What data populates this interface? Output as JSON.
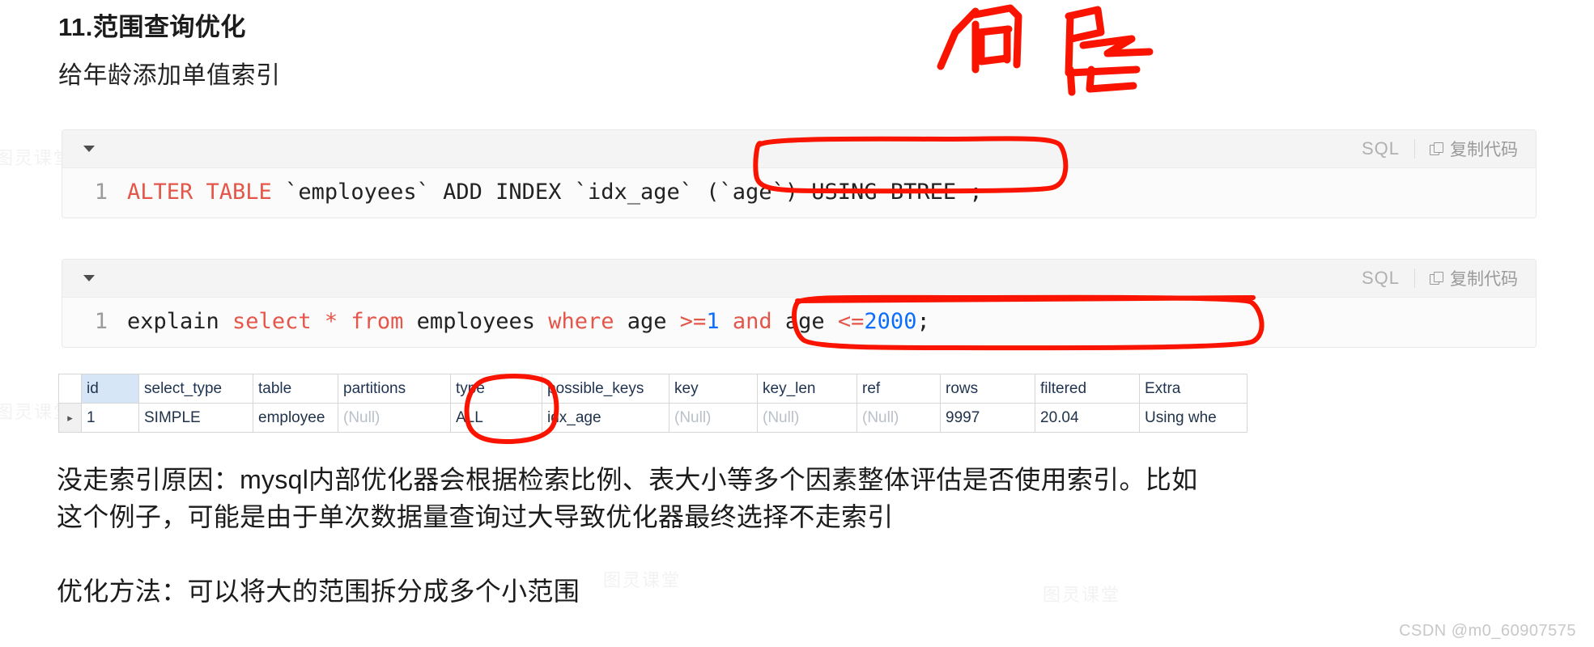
{
  "page": {
    "title": "11.范围查询优化",
    "subtitle": "给年龄添加单值索引",
    "watermark": "CSDN @m0_60907575",
    "bg_watermark": "图灵课堂",
    "accent_red": "#e45649",
    "accent_blue": "#0d6efd",
    "annotation_red": "#fa1400"
  },
  "code_blocks": [
    {
      "lang": "SQL",
      "copy_label": "复制代码",
      "copy_icon": "copy-icon",
      "collapse_icon": "triangle-down-icon",
      "line_number": "1",
      "tokens": [
        {
          "t": "ALTER TABLE",
          "c": "kw"
        },
        {
          "t": " `employees` ADD INDEX `idx_age` (`age`) USING BTREE ;",
          "c": ""
        }
      ],
      "plain": "ALTER TABLE `employees` ADD INDEX `idx_age` (`age`) USING BTREE ;"
    },
    {
      "lang": "SQL",
      "copy_label": "复制代码",
      "copy_icon": "copy-icon",
      "collapse_icon": "triangle-down-icon",
      "line_number": "1",
      "tokens": [
        {
          "t": "explain ",
          "c": ""
        },
        {
          "t": "select",
          "c": "kw"
        },
        {
          "t": " ",
          "c": ""
        },
        {
          "t": "*",
          "c": "op"
        },
        {
          "t": " ",
          "c": ""
        },
        {
          "t": "from",
          "c": "kw"
        },
        {
          "t": " employees ",
          "c": ""
        },
        {
          "t": "where",
          "c": "kw"
        },
        {
          "t": " age ",
          "c": ""
        },
        {
          "t": ">=",
          "c": "op"
        },
        {
          "t": "1",
          "c": "num"
        },
        {
          "t": " ",
          "c": ""
        },
        {
          "t": "and",
          "c": "kw"
        },
        {
          "t": " age ",
          "c": ""
        },
        {
          "t": "<=",
          "c": "op"
        },
        {
          "t": "2000",
          "c": "num"
        },
        {
          "t": ";",
          "c": ""
        }
      ],
      "plain": "explain select * from employees where age >=1 and age <=2000;"
    }
  ],
  "explain_table": {
    "columns": [
      "id",
      "select_type",
      "table",
      "partitions",
      "type",
      "possible_keys",
      "key",
      "key_len",
      "ref",
      "rows",
      "filtered",
      "Extra"
    ],
    "rows": [
      {
        "marker": "▸",
        "id": "1",
        "select_type": "SIMPLE",
        "table": "employee",
        "partitions": "(Null)",
        "type": "ALL",
        "possible_keys": "idx_age",
        "key": "(Null)",
        "key_len": "(Null)",
        "ref": "(Null)",
        "rows": "9997",
        "filtered": "20.04",
        "extra": "Using whe"
      }
    ]
  },
  "paragraphs": {
    "p1_line1": "没走索引原因：mysql内部优化器会根据检索比例、表大小等多个因素整体评估是否使用索引。比如",
    "p1_line2": "这个例子，可能是由于单次数据量查询过大导致优化器最终选择不走索引",
    "p2": "优化方法：可以将大的范围拆分成多个小范围"
  },
  "annotations": {
    "handwriting_top": "何导",
    "circled_items": [
      "`idx_age` (`age`)",
      "age >=1 and age <=2000;",
      "type / ALL"
    ]
  }
}
